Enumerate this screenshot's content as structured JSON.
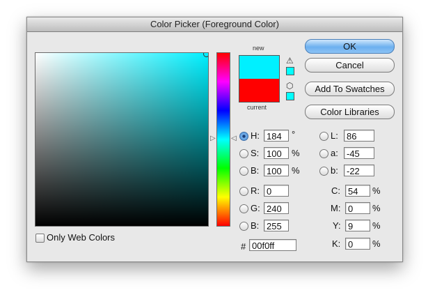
{
  "window": {
    "title": "Color Picker (Foreground Color)"
  },
  "colors": {
    "new": "#00f0ff",
    "current": "#ff0000",
    "hue_field": "#00f0ff",
    "warn_swatch": "#00ffff"
  },
  "preview": {
    "new_label": "new",
    "current_label": "current"
  },
  "buttons": {
    "ok": "OK",
    "cancel": "Cancel",
    "add_to_swatches": "Add To Swatches",
    "color_libraries": "Color Libraries"
  },
  "hsb": {
    "h": {
      "label": "H:",
      "value": "184",
      "unit": "°",
      "selected": true
    },
    "s": {
      "label": "S:",
      "value": "100",
      "unit": "%"
    },
    "b": {
      "label": "B:",
      "value": "100",
      "unit": "%"
    }
  },
  "rgb": {
    "r": {
      "label": "R:",
      "value": "0"
    },
    "g": {
      "label": "G:",
      "value": "240"
    },
    "b": {
      "label": "B:",
      "value": "255"
    }
  },
  "lab": {
    "l": {
      "label": "L:",
      "value": "86"
    },
    "a": {
      "label": "a:",
      "value": "-45"
    },
    "b": {
      "label": "b:",
      "value": "-22"
    }
  },
  "cmyk": {
    "c": {
      "label": "C:",
      "value": "54",
      "unit": "%"
    },
    "m": {
      "label": "M:",
      "value": "0",
      "unit": "%"
    },
    "y": {
      "label": "Y:",
      "value": "9",
      "unit": "%"
    },
    "k": {
      "label": "K:",
      "value": "0",
      "unit": "%"
    }
  },
  "hex": {
    "label": "#",
    "value": "00f0ff"
  },
  "web_colors": {
    "label": "Only Web Colors",
    "checked": false
  },
  "icons": {
    "gamut_warning": "warning-triangle-icon",
    "web_safe": "cube-icon"
  }
}
